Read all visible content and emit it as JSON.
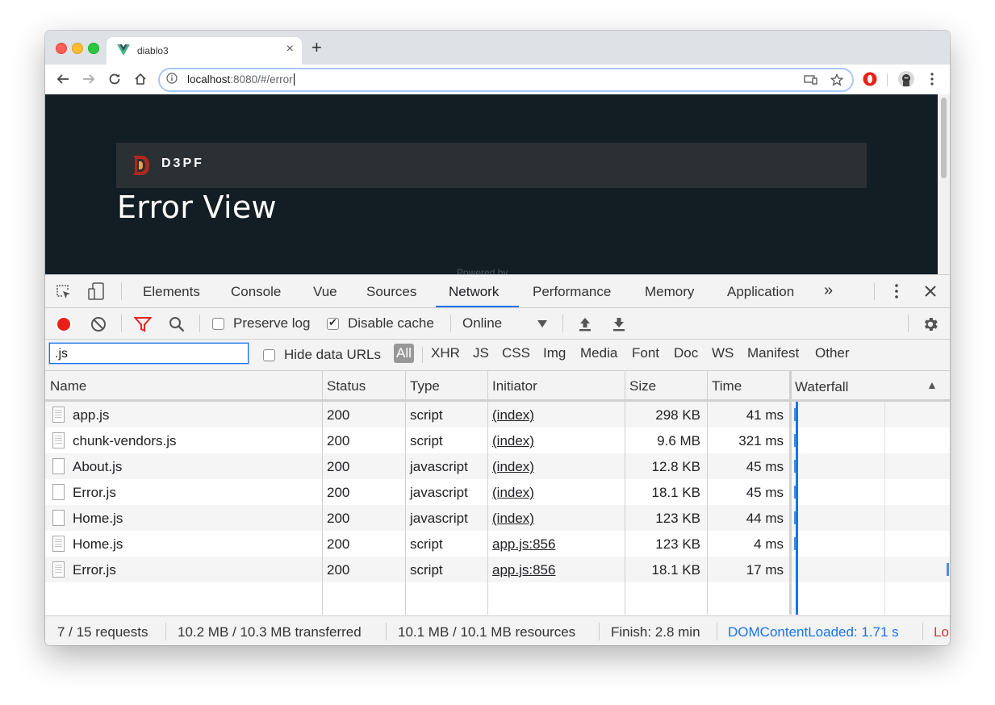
{
  "browser": {
    "tab_title": "diablo3",
    "url_host": "localhost",
    "url_rest": ":8080/#/error"
  },
  "page": {
    "logo_text": "D3PF",
    "title": "Error View",
    "footer_partial": "Powered by"
  },
  "devtools": {
    "tabs": [
      "Elements",
      "Console",
      "Vue",
      "Sources",
      "Network",
      "Performance",
      "Memory",
      "Application"
    ],
    "active_tab": "Network",
    "more_tabs_label": "»",
    "network_toolbar": {
      "preserve_log_label": "Preserve log",
      "preserve_log_checked": false,
      "disable_cache_label": "Disable cache",
      "disable_cache_checked": true,
      "throttling_value": "Online"
    },
    "filter": {
      "value": ".js",
      "hide_data_urls_label": "Hide data URLs",
      "hide_data_urls_checked": false,
      "types": [
        "All",
        "XHR",
        "JS",
        "CSS",
        "Img",
        "Media",
        "Font",
        "Doc",
        "WS",
        "Manifest",
        "Other"
      ],
      "active_type": "All"
    },
    "table": {
      "columns": [
        "Name",
        "Status",
        "Type",
        "Initiator",
        "Size",
        "Time",
        "Waterfall"
      ],
      "sort_indicator": "▲",
      "rows": [
        {
          "name": "app.js",
          "status": "200",
          "type": "script",
          "initiator": "(index)",
          "size": "298 KB",
          "time": "41 ms",
          "icon": "script"
        },
        {
          "name": "chunk-vendors.js",
          "status": "200",
          "type": "script",
          "initiator": "(index)",
          "size": "9.6 MB",
          "time": "321 ms",
          "icon": "script"
        },
        {
          "name": "About.js",
          "status": "200",
          "type": "javascript",
          "initiator": "(index)",
          "size": "12.8 KB",
          "time": "45 ms",
          "icon": "blank"
        },
        {
          "name": "Error.js",
          "status": "200",
          "type": "javascript",
          "initiator": "(index)",
          "size": "18.1 KB",
          "time": "45 ms",
          "icon": "blank"
        },
        {
          "name": "Home.js",
          "status": "200",
          "type": "javascript",
          "initiator": "(index)",
          "size": "123 KB",
          "time": "44 ms",
          "icon": "blank"
        },
        {
          "name": "Home.js",
          "status": "200",
          "type": "script",
          "initiator": "app.js:856",
          "size": "123 KB",
          "time": "4 ms",
          "icon": "script"
        },
        {
          "name": "Error.js",
          "status": "200",
          "type": "script",
          "initiator": "app.js:856",
          "size": "18.1 KB",
          "time": "17 ms",
          "icon": "script"
        }
      ]
    },
    "status": {
      "requests": "7 / 15 requests",
      "transferred": "10.2 MB / 10.3 MB transferred",
      "resources": "10.1 MB / 10.1 MB resources",
      "finish": "Finish: 2.8 min",
      "dom_content_loaded": "DOMContentLoaded: 1.71 s",
      "load_partial": "Lo",
      "dcl_color": "#1a73e8",
      "load_color": "#d03a2f"
    }
  },
  "colors": {
    "page_background": "#121d24",
    "site_header": "#2b3035",
    "record_red": "#e8201a",
    "filter_red": "#e8201a",
    "accent_blue": "#1a73e8"
  }
}
